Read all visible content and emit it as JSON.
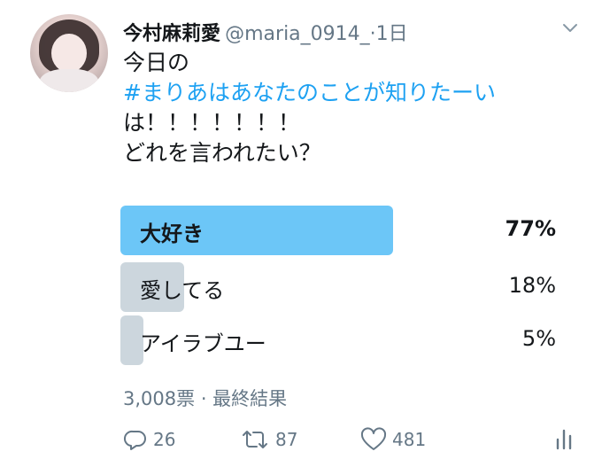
{
  "tweet": {
    "author_name": "今村麻莉愛",
    "handle": "@maria_0914_",
    "time": "1日",
    "line1": "今日の",
    "hashtag": "#まりあはあなたのことが知りたーい",
    "line3": "は！！！！！！！",
    "line4": "どれを言われたい？"
  },
  "poll": {
    "options": [
      {
        "label": "大好き",
        "percent_text": "77%",
        "percent": 77,
        "winner": true
      },
      {
        "label": "愛してる",
        "percent_text": "18%",
        "percent": 18,
        "winner": false
      },
      {
        "label": "アイラブユー",
        "percent_text": "5%",
        "percent": 5,
        "winner": false
      }
    ],
    "votes_text": "3,008票",
    "status_text": "最終結果"
  },
  "actions": {
    "reply_count": "26",
    "retweet_count": "87",
    "like_count": "481"
  },
  "colors": {
    "accent": "#1da1f2",
    "winner_bar": "#6cc6f7",
    "other_bar": "#ccd6dd",
    "muted": "#657786"
  }
}
